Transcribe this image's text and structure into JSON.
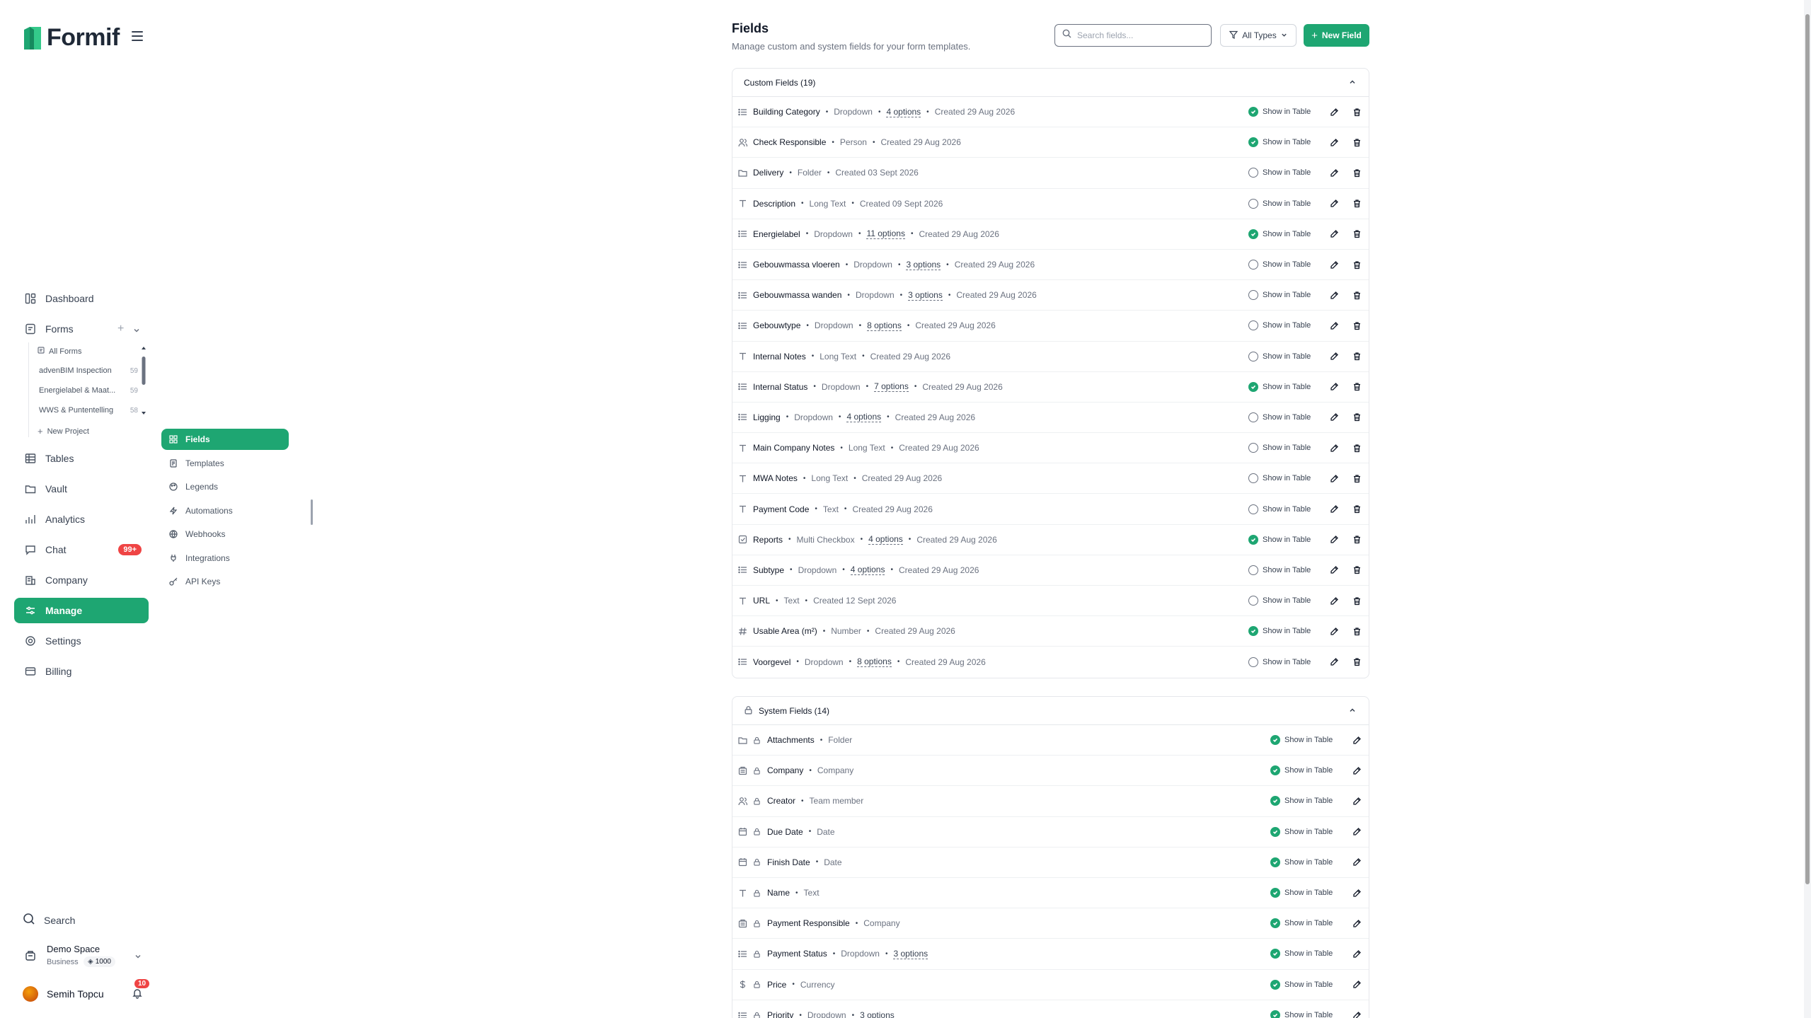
{
  "app": {
    "name": "Formif"
  },
  "nav": {
    "dashboard": "Dashboard",
    "forms": "Forms",
    "tables": "Tables",
    "vault": "Vault",
    "analytics": "Analytics",
    "chat": "Chat",
    "chat_badge": "99+",
    "company": "Company",
    "manage": "Manage",
    "settings": "Settings",
    "billing": "Billing"
  },
  "forms_list": {
    "all_forms": "All Forms",
    "items": [
      {
        "name": "advenBIM Inspection",
        "count": "59"
      },
      {
        "name": "Energielabel & Maat...",
        "count": "59"
      },
      {
        "name": "WWS & Puntentelling",
        "count": "58"
      }
    ],
    "new_project": "New Project"
  },
  "manage_nav": {
    "items": [
      "Fields",
      "Templates",
      "Legends",
      "Automations",
      "Webhooks",
      "Integrations",
      "API Keys"
    ]
  },
  "bottom": {
    "search": "Search",
    "workspace_name": "Demo Space",
    "workspace_plan": "Business",
    "workspace_credits": "1000",
    "user_name": "Semih Topcu",
    "notif_count": "10"
  },
  "page": {
    "title": "Fields",
    "subtitle": "Manage custom and system fields for your form templates.",
    "search_placeholder": "Search fields...",
    "type_filter": "All Types",
    "new_field": "New Field"
  },
  "custom_fields": {
    "header": "Custom Fields (19)",
    "show_label": "Show in Table",
    "rows": [
      {
        "icon": "list",
        "name": "Building Category",
        "type": "Dropdown",
        "options": "4 options",
        "created": "Created 29 Aug 2026",
        "show": true
      },
      {
        "icon": "person",
        "name": "Check Responsible",
        "type": "Person",
        "options": "",
        "created": "Created 29 Aug 2026",
        "show": true
      },
      {
        "icon": "folder",
        "name": "Delivery",
        "type": "Folder",
        "options": "",
        "created": "Created 03 Sept 2026",
        "show": false
      },
      {
        "icon": "text",
        "name": "Description",
        "type": "Long Text",
        "options": "",
        "created": "Created 09 Sept 2026",
        "show": false
      },
      {
        "icon": "list",
        "name": "Energielabel",
        "type": "Dropdown",
        "options": "11 options",
        "created": "Created 29 Aug 2026",
        "show": true
      },
      {
        "icon": "list",
        "name": "Gebouwmassa vloeren",
        "type": "Dropdown",
        "options": "3 options",
        "created": "Created 29 Aug 2026",
        "show": false
      },
      {
        "icon": "list",
        "name": "Gebouwmassa wanden",
        "type": "Dropdown",
        "options": "3 options",
        "created": "Created 29 Aug 2026",
        "show": false
      },
      {
        "icon": "list",
        "name": "Gebouwtype",
        "type": "Dropdown",
        "options": "8 options",
        "created": "Created 29 Aug 2026",
        "show": false
      },
      {
        "icon": "text",
        "name": "Internal Notes",
        "type": "Long Text",
        "options": "",
        "created": "Created 29 Aug 2026",
        "show": false
      },
      {
        "icon": "list",
        "name": "Internal Status",
        "type": "Dropdown",
        "options": "7 options",
        "created": "Created 29 Aug 2026",
        "show": true
      },
      {
        "icon": "list",
        "name": "Ligging",
        "type": "Dropdown",
        "options": "4 options",
        "created": "Created 29 Aug 2026",
        "show": false
      },
      {
        "icon": "text",
        "name": "Main Company Notes",
        "type": "Long Text",
        "options": "",
        "created": "Created 29 Aug 2026",
        "show": false
      },
      {
        "icon": "text",
        "name": "MWA Notes",
        "type": "Long Text",
        "options": "",
        "created": "Created 29 Aug 2026",
        "show": false
      },
      {
        "icon": "text",
        "name": "Payment Code",
        "type": "Text",
        "options": "",
        "created": "Created 29 Aug 2026",
        "show": false
      },
      {
        "icon": "checkbox",
        "name": "Reports",
        "type": "Multi Checkbox",
        "options": "4 options",
        "created": "Created 29 Aug 2026",
        "show": true
      },
      {
        "icon": "list",
        "name": "Subtype",
        "type": "Dropdown",
        "options": "4 options",
        "created": "Created 29 Aug 2026",
        "show": false
      },
      {
        "icon": "text",
        "name": "URL",
        "type": "Text",
        "options": "",
        "created": "Created 12 Sept 2026",
        "show": false
      },
      {
        "icon": "hash",
        "name": "Usable Area (m²)",
        "type": "Number",
        "options": "",
        "created": "Created 29 Aug 2026",
        "show": true
      },
      {
        "icon": "list",
        "name": "Voorgevel",
        "type": "Dropdown",
        "options": "8 options",
        "created": "Created 29 Aug 2026",
        "show": false
      }
    ]
  },
  "system_fields": {
    "header": "System Fields (14)",
    "show_label": "Show in Table",
    "rows": [
      {
        "icon": "folder",
        "name": "Attachments",
        "type": "Folder",
        "options": "",
        "show": true
      },
      {
        "icon": "building",
        "name": "Company",
        "type": "Company",
        "options": "",
        "show": true
      },
      {
        "icon": "person",
        "name": "Creator",
        "type": "Team member",
        "options": "",
        "show": true
      },
      {
        "icon": "calendar",
        "name": "Due Date",
        "type": "Date",
        "options": "",
        "show": true
      },
      {
        "icon": "calendar",
        "name": "Finish Date",
        "type": "Date",
        "options": "",
        "show": true
      },
      {
        "icon": "text",
        "name": "Name",
        "type": "Text",
        "options": "",
        "show": true
      },
      {
        "icon": "building",
        "name": "Payment Responsible",
        "type": "Company",
        "options": "",
        "show": true
      },
      {
        "icon": "list",
        "name": "Payment Status",
        "type": "Dropdown",
        "options": "3 options",
        "show": true
      },
      {
        "icon": "dollar",
        "name": "Price",
        "type": "Currency",
        "options": "",
        "show": true
      },
      {
        "icon": "list",
        "name": "Priority",
        "type": "Dropdown",
        "options": "3 options",
        "show": true
      }
    ]
  },
  "colors": {
    "accent": "#1ea672",
    "badge": "#ef4444"
  }
}
